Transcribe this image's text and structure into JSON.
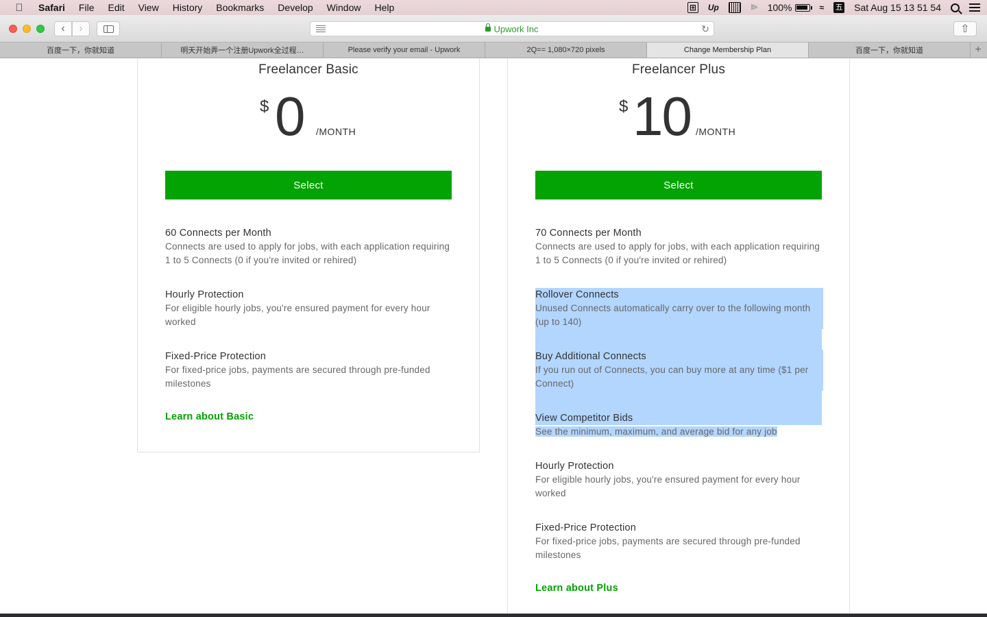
{
  "menubar": {
    "app": "Safari",
    "items": [
      "File",
      "Edit",
      "View",
      "History",
      "Bookmarks",
      "Develop",
      "Window",
      "Help"
    ],
    "status": {
      "battery": "100%",
      "ime_label": "五",
      "up_label": "Up",
      "datetime": "Sat Aug 15  13 51 54"
    }
  },
  "browser": {
    "url_text": "Upwork Inc",
    "tabs": [
      "百度一下，你就知道",
      "明天开始弄一个注册Upwork全过程…",
      "Please verify your email - Upwork",
      "2Q== 1,080×720 pixels",
      "Change Membership Plan",
      "百度一下，你就知道"
    ],
    "active_tab_index": 4
  },
  "plans": {
    "basic": {
      "title": "Freelancer Basic",
      "currency": "$",
      "amount": "0",
      "period": "/MONTH",
      "select_label": "Select",
      "features": [
        {
          "title": "60 Connects per Month",
          "desc": "Connects are used to apply for jobs, with each application requiring 1 to 5 Connects (0 if you're invited or rehired)"
        },
        {
          "title": "Hourly Protection",
          "desc": "For eligible hourly jobs, you're ensured payment for every hour worked"
        },
        {
          "title": "Fixed-Price Protection",
          "desc": "For fixed-price jobs, payments are secured through pre-funded milestones"
        }
      ],
      "learn_label": "Learn about Basic"
    },
    "plus": {
      "title": "Freelancer Plus",
      "currency": "$",
      "amount": "10",
      "period": "/MONTH",
      "select_label": "Select",
      "features": [
        {
          "title": "70 Connects per Month",
          "desc": "Connects are used to apply for jobs, with each application requiring 1 to 5 Connects (0 if you're invited or rehired)"
        },
        {
          "title": "Rollover Connects",
          "desc": "Unused Connects automatically carry over to the following month (up to 140)"
        },
        {
          "title": "Buy Additional Connects",
          "desc": "If you run out of Connects, you can buy more at any time ($1 per Connect)"
        },
        {
          "title": "View Competitor Bids",
          "desc": "See the minimum, maximum, and average bid for any job"
        },
        {
          "title": "Hourly Protection",
          "desc": "For eligible hourly jobs, you're ensured payment for every hour worked"
        },
        {
          "title": "Fixed-Price Protection",
          "desc": "For fixed-price jobs, payments are secured through pre-funded milestones"
        }
      ],
      "learn_label": "Learn about Plus"
    }
  },
  "colors": {
    "accent_green": "#02a302",
    "selection_highlight": "#b2d6fe"
  }
}
